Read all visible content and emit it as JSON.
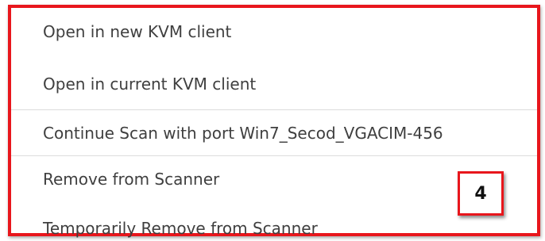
{
  "context_menu": {
    "items": [
      {
        "label": "Open in new KVM client"
      },
      {
        "label": "Open in current KVM client"
      },
      {
        "label": "Continue Scan with port Win7_Secod_VGACIM-456"
      },
      {
        "label": "Remove from Scanner"
      },
      {
        "label": "Temporarily Remove from Scanner"
      }
    ]
  },
  "callout": {
    "number": "4",
    "color": "#e8161c"
  }
}
